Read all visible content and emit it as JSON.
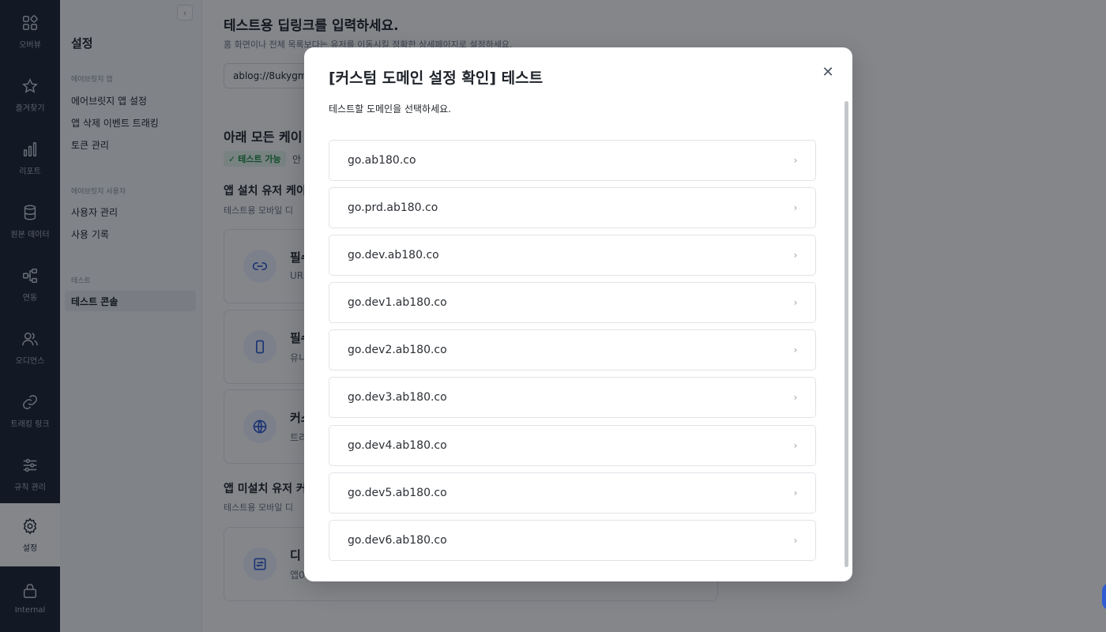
{
  "rail": {
    "items": [
      {
        "label": "오버뷰",
        "icon": "dashboard-icon"
      },
      {
        "label": "즐겨찾기",
        "icon": "star-icon"
      },
      {
        "label": "리포트",
        "icon": "bar-chart-icon"
      },
      {
        "label": "원본 데이터",
        "icon": "database-icon"
      },
      {
        "label": "연동",
        "icon": "integration-icon"
      },
      {
        "label": "오디언스",
        "icon": "audience-icon"
      },
      {
        "label": "트래킹 링크",
        "icon": "link-icon"
      },
      {
        "label": "규칙 관리",
        "icon": "sliders-icon"
      },
      {
        "label": "설정",
        "icon": "gear-icon",
        "active": true
      },
      {
        "label": "Internal",
        "icon": "lock-icon"
      }
    ]
  },
  "sidebar": {
    "title": "설정",
    "groups": [
      {
        "label": "에어브릿지 앱",
        "items": [
          "에어브릿지 앱 설정",
          "앱 삭제 이벤트 트래킹",
          "토큰 관리"
        ]
      },
      {
        "label": "에어브릿지 사용자",
        "items": [
          "사용자 관리",
          "사용 기록"
        ]
      },
      {
        "label": "테스트",
        "items": [
          "테스트 콘솔"
        ]
      }
    ],
    "active_item": "테스트 콘솔"
  },
  "main": {
    "heading": "테스트용 딥링크를 입력하세요.",
    "subheading": "홈 화면이나 전체 목록보다는 유저를 이동시킬 정확한 상세페이지로 설정하세요.",
    "deeplink_value": "ablog://8ukygm",
    "section_title": "아래 모든 케이",
    "badge": "테스트 가능",
    "badge_after": "안",
    "installed_title": "앱 설치 유저 케이",
    "installed_desc": "테스트용 모바일 디",
    "cards": [
      {
        "title": "필수",
        "desc": "UR",
        "icon": "link-icon"
      },
      {
        "title": "필수",
        "desc": "유니",
        "icon": "phone-icon"
      },
      {
        "title": "커스",
        "desc": "트리",
        "icon": "globe-icon"
      }
    ],
    "not_installed_title": "앱 미설치 유저 커",
    "not_installed_desc": "테스트용 모바일 디",
    "card4": {
      "title": "디",
      "desc": "앱0",
      "icon": "deferred-link-icon"
    }
  },
  "modal": {
    "title": "[커스텀 도메인 설정 확인] 테스트",
    "description": "테스트할 도메인을 선택하세요.",
    "close_icon": "close-icon",
    "domains": [
      "go.ab180.co",
      "go.prd.ab180.co",
      "go.dev.ab180.co",
      "go.dev1.ab180.co",
      "go.dev2.ab180.co",
      "go.dev3.ab180.co",
      "go.dev4.ab180.co",
      "go.dev5.ab180.co",
      "go.dev6.ab180.co"
    ]
  },
  "colors": {
    "rail_bg": "#1c2433",
    "accent": "#2f5bd3",
    "badge_green": "#1a8a43",
    "overlay": "rgba(10,14,22,0.5)"
  }
}
